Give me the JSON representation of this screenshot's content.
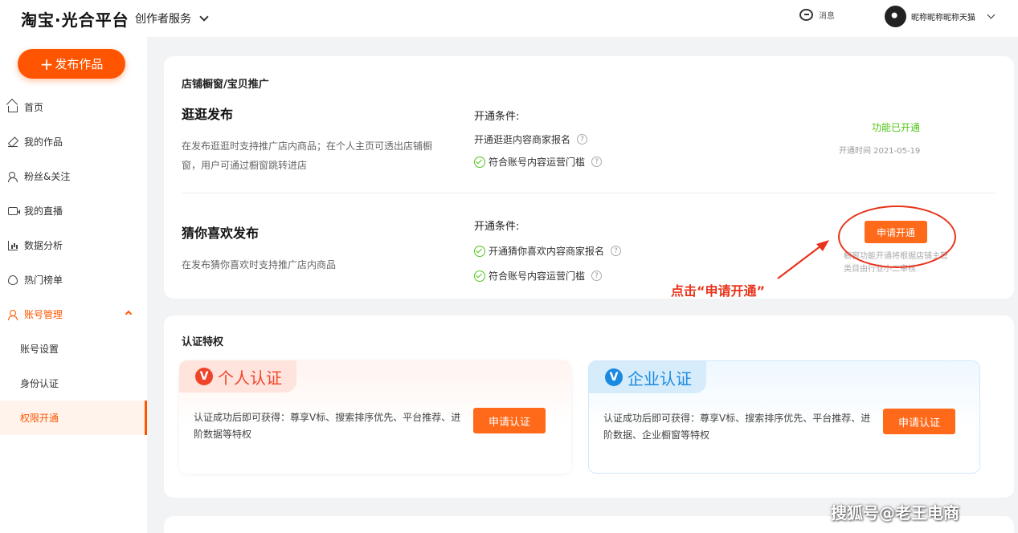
{
  "header": {
    "logo": "淘宝·光合平台",
    "service_menu": "创作者服务",
    "messages_label": "消息",
    "username": "昵称昵称昵称天猫"
  },
  "sidebar": {
    "publish_label": "发布作品",
    "items": [
      {
        "label": "首页",
        "icon": "home-icon"
      },
      {
        "label": "我的作品",
        "icon": "pen-icon"
      },
      {
        "label": "粉丝&关注",
        "icon": "fans-icon"
      },
      {
        "label": "我的直播",
        "icon": "live-icon"
      },
      {
        "label": "数据分析",
        "icon": "chart-icon"
      },
      {
        "label": "热门榜单",
        "icon": "fire-icon"
      },
      {
        "label": "账号管理",
        "icon": "user-icon"
      }
    ],
    "sub_items": [
      "账号设置",
      "身份认证",
      "权限开通"
    ]
  },
  "shop_section": {
    "title": "店铺橱窗/宝贝推广",
    "feature1": {
      "title": "逛逛发布",
      "desc": "在发布逛逛时支持推广店内商品；在个人主页可透出店铺橱窗，用户可通过橱窗跳转进店",
      "cond_title": "开通条件:",
      "cond1": "开通逛逛内容商家报名",
      "cond2": "符合账号内容运营门槛",
      "status": "功能已开通",
      "open_time": "开通时间 2021-05-19"
    },
    "feature2": {
      "title": "猜你喜欢发布",
      "desc": "在发布猜你喜欢时支持推广店内商品",
      "cond_title": "开通条件:",
      "cond1": "开通猜你喜欢内容商家报名",
      "cond2": "符合账号内容运营门槛",
      "apply_label": "申请开通",
      "note": "橱窗功能开通将根据店铺主营类目由行业小二审核"
    },
    "annotation": "点击“申请开通”"
  },
  "cert_section": {
    "title": "认证特权",
    "personal": {
      "tag": "个人认证",
      "desc": "认证成功后即可获得：尊享V标、搜索排序优先、平台推荐、进阶数据等特权",
      "button": "申请认证"
    },
    "enterprise": {
      "tag": "企业认证",
      "desc": "认证成功后即可获得：尊享V标、搜索排序优先、平台推荐、进阶数据、企业橱窗等特权",
      "button": "申请认证"
    }
  },
  "watermark": "搜狐号@老王电商",
  "colors": {
    "accent": "#ff5500",
    "success": "#52c41a",
    "annotation": "#e8341c",
    "enterprise": "#1a8ae0"
  }
}
